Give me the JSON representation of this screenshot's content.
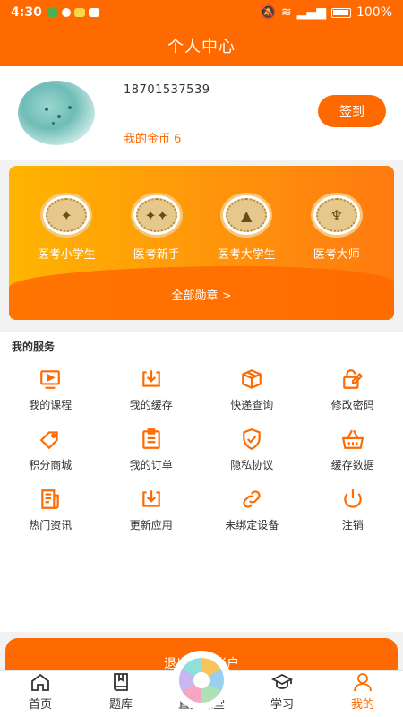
{
  "status_bar": {
    "time": "4:30",
    "battery": "100%"
  },
  "header": {
    "title": "个人中心"
  },
  "profile": {
    "phone": "18701537539",
    "coins_label": "我的金币 6",
    "signin_label": "签到"
  },
  "medals": {
    "items": [
      {
        "label": "医考小学生",
        "icon": "medal-icon"
      },
      {
        "label": "医考新手",
        "icon": "medal-icon"
      },
      {
        "label": "医考大学生",
        "icon": "medal-icon"
      },
      {
        "label": "医考大师",
        "icon": "trophy-medal-icon"
      }
    ],
    "all_label": "全部勋章 >"
  },
  "services": {
    "title": "我的服务",
    "items": [
      {
        "label": "我的课程",
        "icon": "video-play-icon"
      },
      {
        "label": "我的缓存",
        "icon": "download-tray-icon"
      },
      {
        "label": "快递查询",
        "icon": "package-box-icon"
      },
      {
        "label": "修改密码",
        "icon": "edit-lock-icon"
      },
      {
        "label": "积分商城",
        "icon": "tag-icon"
      },
      {
        "label": "我的订单",
        "icon": "clipboard-list-icon"
      },
      {
        "label": "隐私协议",
        "icon": "shield-check-icon"
      },
      {
        "label": "缓存数据",
        "icon": "basket-icon"
      },
      {
        "label": "热门资讯",
        "icon": "news-document-icon"
      },
      {
        "label": "更新应用",
        "icon": "update-download-icon"
      },
      {
        "label": "未绑定设备",
        "icon": "link-chain-icon"
      },
      {
        "label": "注销",
        "icon": "power-icon"
      }
    ]
  },
  "logout": {
    "label": "退出当前账户"
  },
  "tabbar": {
    "items": [
      {
        "label": "首页",
        "icon": "home-icon"
      },
      {
        "label": "题库",
        "icon": "book-icon"
      },
      {
        "label": "直播课堂",
        "icon": "live-wheel-icon"
      },
      {
        "label": "学习",
        "icon": "graduation-cap-icon"
      },
      {
        "label": "我的",
        "icon": "user-icon"
      }
    ],
    "active_index": 4
  },
  "colors": {
    "primary": "#ff6a00",
    "medal_gradient_start": "#ffb400",
    "medal_gradient_end": "#ff7a10"
  }
}
